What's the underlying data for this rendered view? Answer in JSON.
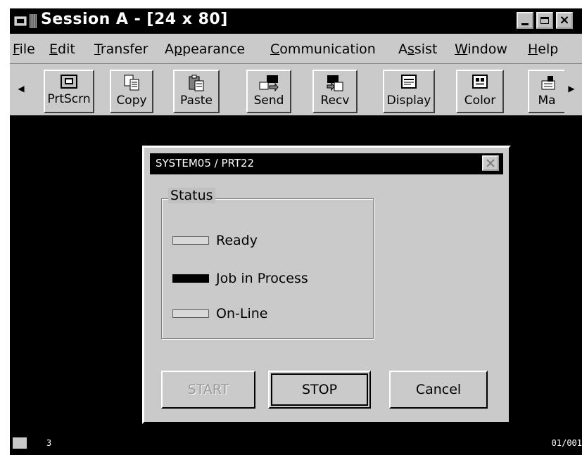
{
  "window": {
    "title": "Session A - [24 x 80]"
  },
  "menu": [
    {
      "label": "File",
      "mnemonic": "F",
      "rest": "ile"
    },
    {
      "label": "Edit",
      "mnemonic": "E",
      "rest": "dit"
    },
    {
      "label": "Transfer",
      "mnemonic": "T",
      "rest": "ransfer"
    },
    {
      "label": "Appearance",
      "pre": "A",
      "mnemonic": "p",
      "rest": "pearance"
    },
    {
      "label": "Communication",
      "mnemonic": "C",
      "rest": "ommunication"
    },
    {
      "label": "Assist",
      "pre": "A",
      "mnemonic": "s",
      "rest": "sist"
    },
    {
      "label": "Window",
      "mnemonic": "W",
      "rest": "indow"
    },
    {
      "label": "Help",
      "mnemonic": "H",
      "rest": "elp"
    }
  ],
  "toolbar": {
    "items": [
      {
        "label": "PrtScrn",
        "icon": "print-screen-icon"
      },
      {
        "label": "Copy",
        "icon": "copy-icon"
      },
      {
        "label": "Paste",
        "icon": "paste-icon"
      },
      {
        "label": "Send",
        "icon": "send-icon"
      },
      {
        "label": "Recv",
        "icon": "receive-icon"
      },
      {
        "label": "Display",
        "icon": "display-icon"
      },
      {
        "label": "Color",
        "icon": "color-icon"
      },
      {
        "label": "Ma",
        "icon": "macro-icon"
      }
    ]
  },
  "dialog": {
    "title": "SYSTEM05 / PRT22",
    "group_label": "Status",
    "statuses": [
      {
        "label": "Ready",
        "indicator": "light"
      },
      {
        "label": "Job in Process",
        "indicator": "dark"
      },
      {
        "label": "On-Line",
        "indicator": "light"
      }
    ],
    "buttons": {
      "start": "START",
      "stop": "STOP",
      "cancel": "Cancel"
    }
  },
  "statusbar": {
    "session_number": "3",
    "cursor_position": "01/001"
  },
  "colors": {
    "face": "#c0c0c0",
    "title_bar": "#000000",
    "screen": "#000000"
  }
}
